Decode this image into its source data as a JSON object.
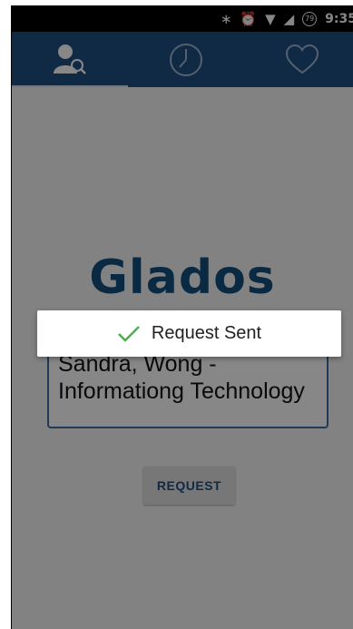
{
  "status_bar": {
    "icons": [
      "bluetooth-icon",
      "alarm-icon",
      "wifi-icon",
      "signal-icon",
      "battery-saver-icon"
    ],
    "bluetooth_glyph": "∗",
    "alarm_glyph": "⏰",
    "wifi_glyph": "▼",
    "signal_glyph": "◢",
    "battery_badge": "79",
    "time": "9:35"
  },
  "tabs": [
    {
      "icon": "user-search-icon",
      "selected": true
    },
    {
      "icon": "clock-icon",
      "selected": false
    },
    {
      "icon": "heart-icon",
      "selected": false
    }
  ],
  "app": {
    "logo": "Glados",
    "field_value": "Sandra, Wong - Informationg Technology",
    "request_label": "REQUEST"
  },
  "toast": {
    "icon": "check-icon",
    "message": "Request Sent"
  },
  "colors": {
    "primary": "#1f4f83",
    "logo": "#14507f",
    "check": "#4caf50",
    "scrim": "rgba(0,0,0,0.47)"
  }
}
